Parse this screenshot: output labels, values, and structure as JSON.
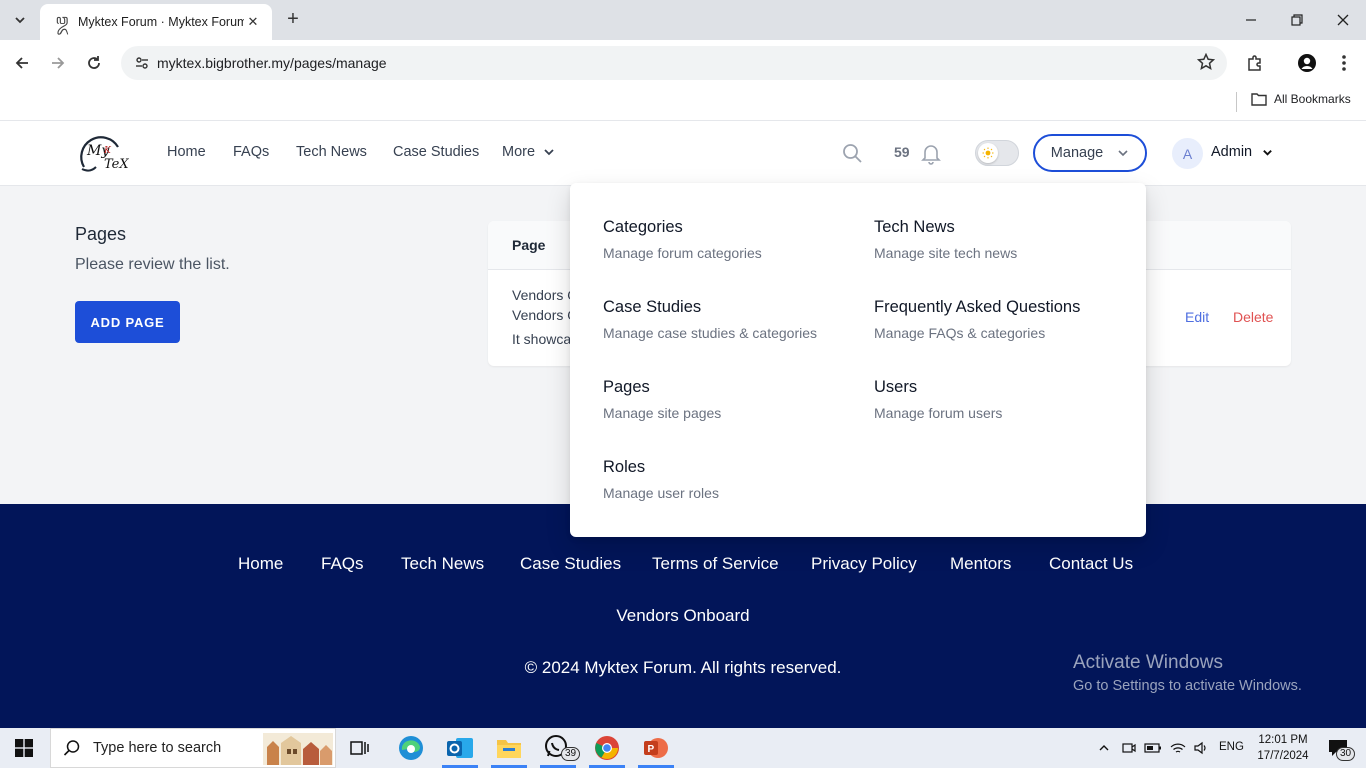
{
  "browser": {
    "tab_title": "Myktex Forum · Myktex Forum",
    "url": "myktex.bigbrother.my/pages/manage",
    "bookmarks_label": "All Bookmarks"
  },
  "header": {
    "logo_text": "MyKTeX",
    "nav": [
      "Home",
      "FAQs",
      "Tech News",
      "Case Studies"
    ],
    "more_label": "More",
    "notification_count": "59",
    "manage_label": "Manage",
    "avatar_initial": "A",
    "user_name": "Admin"
  },
  "main": {
    "title": "Pages",
    "subtitle": "Please review the list.",
    "add_button": "ADD PAGE",
    "table_header": "Page",
    "row": {
      "line1": "Vendors O",
      "line2": "Vendors O",
      "line3": "It showca",
      "edit": "Edit",
      "delete": "Delete"
    }
  },
  "dropdown": {
    "items": [
      {
        "title": "Categories",
        "desc": "Manage forum categories"
      },
      {
        "title": "Tech News",
        "desc": "Manage site tech news"
      },
      {
        "title": "Case Studies",
        "desc": "Manage case studies & categories"
      },
      {
        "title": "Frequently Asked Questions",
        "desc": "Manage FAQs & categories"
      },
      {
        "title": "Pages",
        "desc": "Manage site pages"
      },
      {
        "title": "Users",
        "desc": "Manage forum users"
      },
      {
        "title": "Roles",
        "desc": "Manage user roles"
      }
    ]
  },
  "footer": {
    "links": [
      "Home",
      "FAQs",
      "Tech News",
      "Case Studies",
      "Terms of Service",
      "Privacy Policy",
      "Mentors",
      "Contact Us"
    ],
    "vendors": "Vendors Onboard",
    "copyright": "© 2024 Myktex Forum. All rights reserved."
  },
  "watermark": {
    "line1": "Activate Windows",
    "line2": "Go to Settings to activate Windows."
  },
  "taskbar": {
    "search_placeholder": "Type here to search",
    "whatsapp_badge": "39",
    "language": "ENG",
    "time": "12:01 PM",
    "date": "17/7/2024",
    "notification_badge": "30"
  },
  "colors": {
    "primary": "#1d4ed8",
    "footer_bg": "#021559",
    "edit_link": "#4f6fe0",
    "delete_link": "#e05252"
  }
}
